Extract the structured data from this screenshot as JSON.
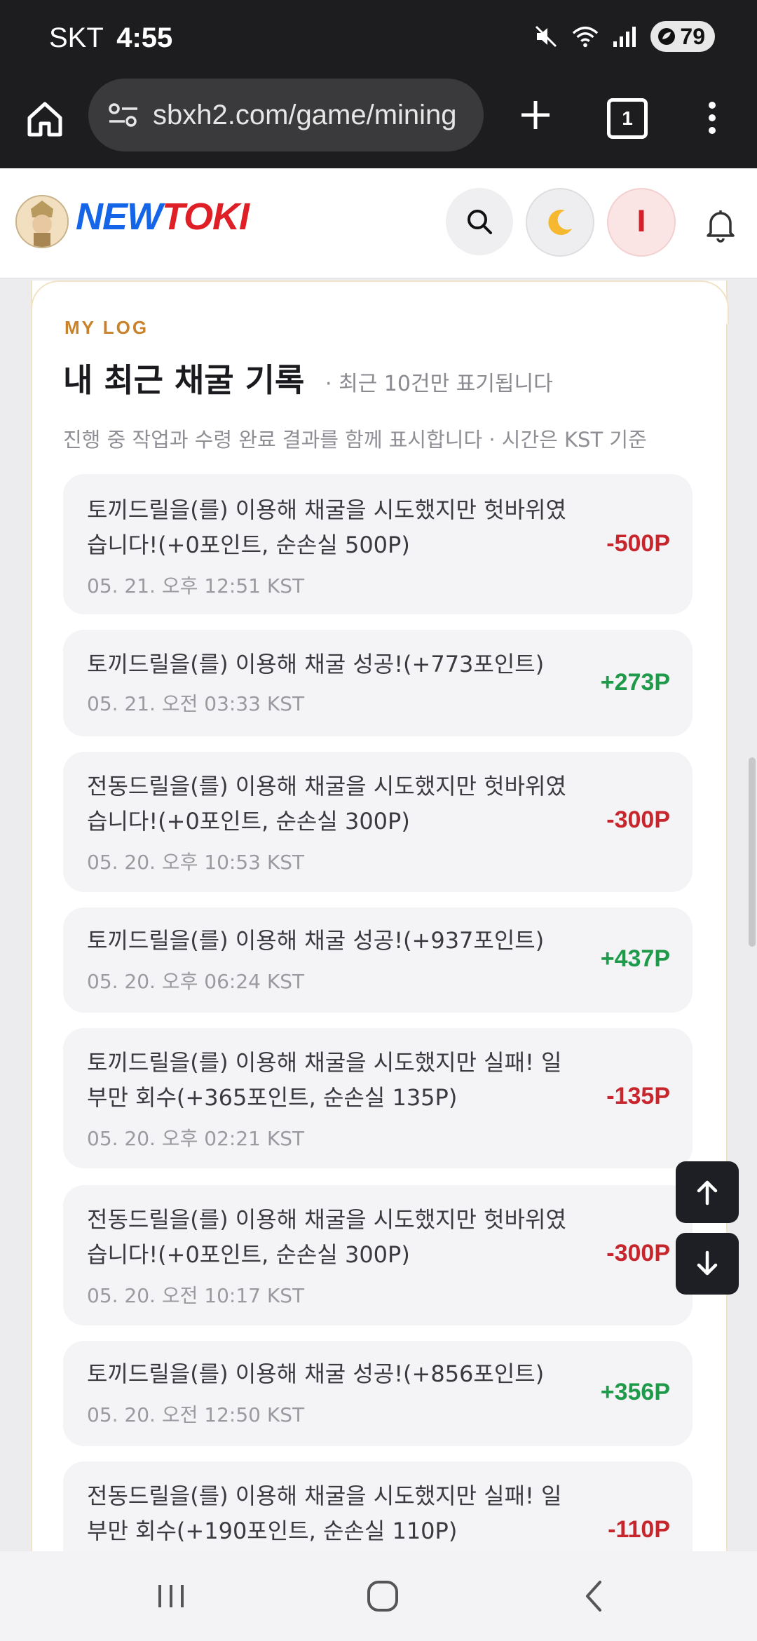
{
  "status_bar": {
    "carrier": "SKT",
    "time": "4:55",
    "battery": "79"
  },
  "browser": {
    "url": "sbxh2.com/game/mining",
    "tab_count": "1"
  },
  "header": {
    "logo_part1": "NEW",
    "logo_part2": "TOKI",
    "user_initial": "l"
  },
  "log": {
    "eyebrow": "MY LOG",
    "title": "내 최근 채굴 기록",
    "subtitle": "· 최근 10건만 표기됩니다",
    "description": "진행 중 작업과 수령 완료 결과를 함께 표시합니다 · 시간은 KST 기준",
    "entries": [
      {
        "text": "토끼드릴을(를) 이용해 채굴을 시도했지만 헛바위였습니다!(+0포인트, 순손실 500P)",
        "date": "05. 21. 오후 12:51 KST",
        "amount": "-500P",
        "sign": "neg"
      },
      {
        "text": "토끼드릴을(를) 이용해 채굴 성공!(+773포인트)",
        "date": "05. 21. 오전 03:33 KST",
        "amount": "+273P",
        "sign": "pos"
      },
      {
        "text": "전동드릴을(를) 이용해 채굴을 시도했지만 헛바위였습니다!(+0포인트, 순손실 300P)",
        "date": "05. 20. 오후 10:53 KST",
        "amount": "-300P",
        "sign": "neg"
      },
      {
        "text": "토끼드릴을(를) 이용해 채굴 성공!(+937포인트)",
        "date": "05. 20. 오후 06:24 KST",
        "amount": "+437P",
        "sign": "pos"
      },
      {
        "text": "토끼드릴을(를) 이용해 채굴을 시도했지만 실패! 일부만 회수(+365포인트, 순손실 135P)",
        "date": "05. 20. 오후 02:21 KST",
        "amount": "-135P",
        "sign": "neg"
      },
      {
        "text": "전동드릴을(를) 이용해 채굴을 시도했지만 헛바위였습니다!(+0포인트, 순손실 300P)",
        "date": "05. 20. 오전 10:17 KST",
        "amount": "-300P",
        "sign": "neg"
      },
      {
        "text": "토끼드릴을(를) 이용해 채굴 성공!(+856포인트)",
        "date": "05. 20. 오전 12:50 KST",
        "amount": "+356P",
        "sign": "pos"
      },
      {
        "text": "전동드릴을(를) 이용해 채굴을 시도했지만 실패! 일부만 회수(+190포인트, 순손실 110P)",
        "date": "",
        "amount": "-110P",
        "sign": "neg"
      }
    ]
  },
  "colors": {
    "negative": "#c8262d",
    "positive": "#1f9a4a",
    "accent": "#c9822a",
    "logo_blue": "#1565e8",
    "logo_red": "#e01e26"
  }
}
